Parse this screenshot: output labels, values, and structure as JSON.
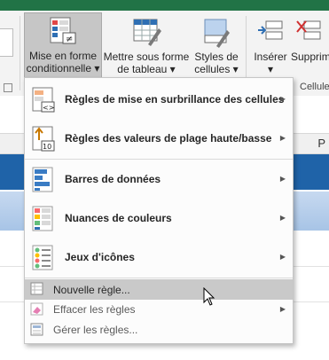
{
  "ribbon": {
    "mise_en_forme": {
      "line1": "Mise en forme",
      "line2": "conditionnelle"
    },
    "mettre_sous_forme": {
      "line1": "Mettre sous forme",
      "line2": "de tableau"
    },
    "styles": {
      "line1": "Styles de",
      "line2": "cellules"
    },
    "inserer": {
      "line1": "Insérer"
    },
    "supprimer": {
      "line1": "Supprim"
    },
    "cellules_group": "Cellule"
  },
  "sheet": {
    "header_cell": "P"
  },
  "menu": {
    "items": [
      {
        "label": "Règles de mise en surbrillance des cellules",
        "icon": "highlight-cells-rules-icon",
        "submenu": true
      },
      {
        "label": "Règles des valeurs de plage haute/basse",
        "icon": "top-bottom-rules-icon",
        "submenu": true
      },
      {
        "label": "Barres de données",
        "icon": "data-bars-icon",
        "submenu": true
      },
      {
        "label": "Nuances de couleurs",
        "icon": "color-scales-icon",
        "submenu": true
      },
      {
        "label": "Jeux d'icônes",
        "icon": "icon-sets-icon",
        "submenu": true
      },
      {
        "label": "Nouvelle règle...",
        "icon": "new-rule-icon",
        "submenu": false,
        "highlighted": true
      },
      {
        "label": "Effacer les règles",
        "icon": "clear-rules-icon",
        "submenu": true
      },
      {
        "label": "Gérer les règles...",
        "icon": "manage-rules-icon",
        "submenu": false
      }
    ]
  },
  "colors": {
    "excel_green": "#217346",
    "table_blue": "#1f63a8",
    "hover_gray": "#c9c9c9"
  }
}
